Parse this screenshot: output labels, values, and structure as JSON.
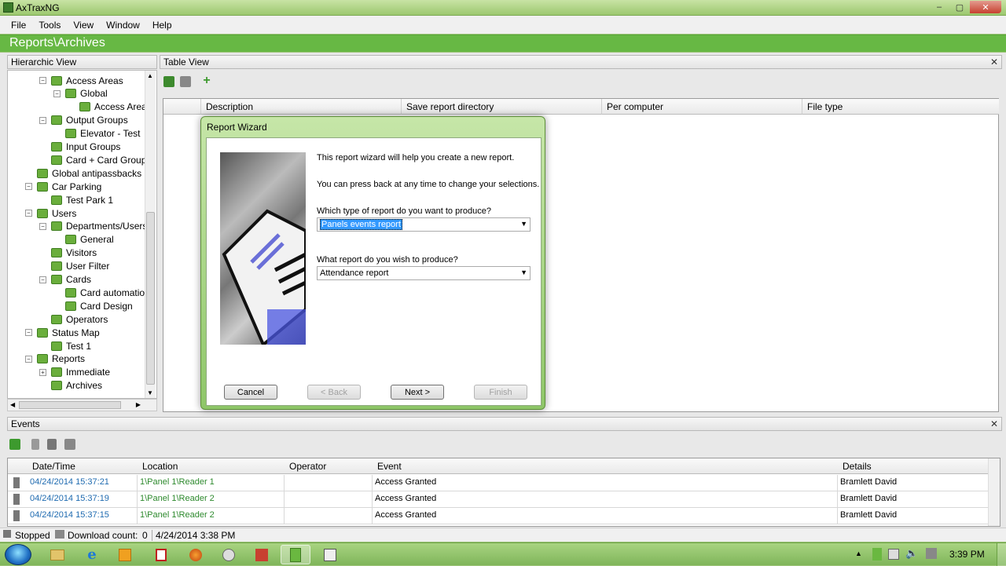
{
  "window": {
    "title": "AxTraxNG",
    "min": "–",
    "max": "▢",
    "close": "✕"
  },
  "menu": [
    "File",
    "Tools",
    "View",
    "Window",
    "Help"
  ],
  "banner": "Reports\\Archives",
  "hier_title": "Hierarchic View",
  "table_title": "Table View",
  "tree": [
    {
      "label": "Access Areas",
      "indent": 1,
      "exp": "−"
    },
    {
      "label": "Global",
      "indent": 2,
      "exp": "−"
    },
    {
      "label": "Access Area",
      "indent": 3,
      "exp": ""
    },
    {
      "label": "Output Groups",
      "indent": 1,
      "exp": "−"
    },
    {
      "label": "Elevator - Test",
      "indent": 2,
      "exp": ""
    },
    {
      "label": "Input Groups",
      "indent": 1,
      "exp": ""
    },
    {
      "label": "Card + Card Groups",
      "indent": 1,
      "exp": ""
    },
    {
      "label": "Global antipassbacks",
      "indent": 0,
      "exp": ""
    },
    {
      "label": "Car Parking",
      "indent": 0,
      "exp": "−"
    },
    {
      "label": "Test Park 1",
      "indent": 1,
      "exp": ""
    },
    {
      "label": "Users",
      "indent": 0,
      "exp": "−"
    },
    {
      "label": "Departments/Users",
      "indent": 1,
      "exp": "−"
    },
    {
      "label": "General",
      "indent": 2,
      "exp": ""
    },
    {
      "label": "Visitors",
      "indent": 1,
      "exp": ""
    },
    {
      "label": "User Filter",
      "indent": 1,
      "exp": ""
    },
    {
      "label": "Cards",
      "indent": 1,
      "exp": "−"
    },
    {
      "label": "Card automation",
      "indent": 2,
      "exp": ""
    },
    {
      "label": "Card Design",
      "indent": 2,
      "exp": ""
    },
    {
      "label": "Operators",
      "indent": 1,
      "exp": ""
    },
    {
      "label": "Status Map",
      "indent": 0,
      "exp": "−"
    },
    {
      "label": "Test 1",
      "indent": 1,
      "exp": ""
    },
    {
      "label": "Reports",
      "indent": 0,
      "exp": "−"
    },
    {
      "label": "Immediate",
      "indent": 1,
      "exp": "+"
    },
    {
      "label": "Archives",
      "indent": 1,
      "exp": ""
    }
  ],
  "table_columns": [
    "Description",
    "Save report directory",
    "Per computer",
    "File type"
  ],
  "wizard": {
    "title": "Report Wizard",
    "intro1": "This report wizard will help you create a new report.",
    "intro2": "You can press back at any time to change your selections.",
    "q1": "Which type of report do you want to produce?",
    "q1_value": "Panels events report",
    "q2": "What report do you wish to produce?",
    "q2_value": "Attendance report",
    "cancel": "Cancel",
    "back": "< Back",
    "next": "Next >",
    "finish": "Finish"
  },
  "events_title": "Events",
  "events_columns": [
    "Date/Time",
    "Location",
    "Operator",
    "Event",
    "Details"
  ],
  "events": [
    {
      "datetime": "04/24/2014 15:37:21",
      "location": "1\\Panel 1\\Reader 1",
      "operator": "",
      "event": "Access Granted",
      "details": "Bramlett David"
    },
    {
      "datetime": "04/24/2014 15:37:19",
      "location": "1\\Panel 1\\Reader 2",
      "operator": "",
      "event": "Access Granted",
      "details": "Bramlett David"
    },
    {
      "datetime": "04/24/2014 15:37:15",
      "location": "1\\Panel 1\\Reader 2",
      "operator": "",
      "event": "Access Granted",
      "details": "Bramlett David"
    }
  ],
  "status": {
    "state": "Stopped",
    "download_label": "Download count:",
    "download_count": "0",
    "datetime": "4/24/2014 3:38 PM"
  },
  "taskbar": {
    "clock": "3:39 PM"
  },
  "colors": {
    "accent": "#67b844",
    "titlebar": "#9cc86f"
  }
}
